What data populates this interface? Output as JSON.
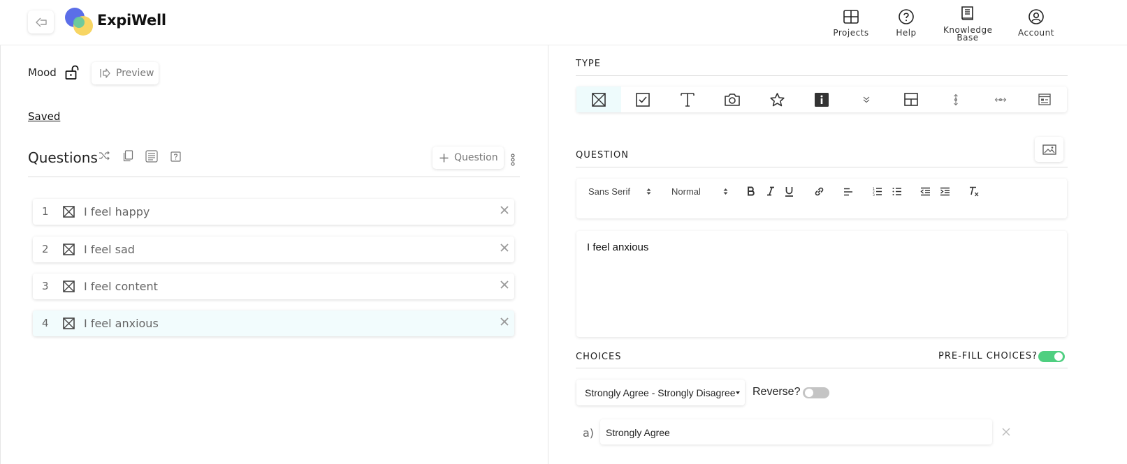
{
  "header": {
    "brand": "ExpiWell",
    "nav": [
      {
        "label": "Projects",
        "icon": "grid-icon"
      },
      {
        "label": "Help",
        "icon": "help-circle-icon"
      },
      {
        "label": "Knowledge Base",
        "icon": "book-icon"
      },
      {
        "label": "Account",
        "icon": "user-circle-icon"
      }
    ]
  },
  "survey": {
    "name": "Mood",
    "preview_label": "Preview",
    "status": "Saved"
  },
  "questions": {
    "title": "Questions",
    "add_label": "Question",
    "items": [
      {
        "number": "1",
        "text": "I feel happy"
      },
      {
        "number": "2",
        "text": "I feel sad"
      },
      {
        "number": "3",
        "text": "I feel content"
      },
      {
        "number": "4",
        "text": "I feel anxious"
      }
    ]
  },
  "editor": {
    "type_label": "TYPE",
    "question_label": "QUESTION",
    "font_family": "Sans Serif",
    "font_size": "Normal",
    "question_text": "I feel anxious",
    "choices_label": "CHOICES",
    "prefill_label": "PRE-FILL CHOICES?",
    "prefill_on": true,
    "scale": "Strongly Agree - Strongly Disagree",
    "reverse_label": "Reverse?",
    "reverse_on": false,
    "choices": [
      {
        "letter": "a)",
        "text": "Strongly Agree"
      }
    ]
  },
  "colors": {
    "accent_green": "#4fcf80",
    "selected_bg": "#f2fcfd"
  }
}
